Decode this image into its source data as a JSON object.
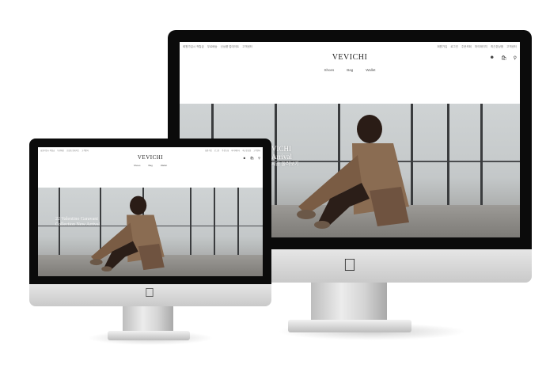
{
  "site": {
    "brand": "VEVICHI",
    "nav": [
      "Shoes",
      "Bag",
      "Wallet"
    ],
    "top_left_links": [
      "회원가입시 적립금",
      "무료배송",
      "신상품 업데이트",
      "고객센터"
    ],
    "top_right_links": [
      "회원가입",
      "로그인",
      "주문조회",
      "마이페이지",
      "최근본상품",
      "고객센터"
    ],
    "icons": [
      "user-icon",
      "bag-icon",
      "search-icon"
    ]
  },
  "hero": {
    "large_caption_line1": "VICHI",
    "large_caption_line2": "Arrival",
    "large_caption_line3": "지금 둘러보기",
    "small_caption_line1": "22 Valentino Garavani",
    "small_caption_line2": "Collection New Arrival"
  },
  "colors": {
    "bezel": "#0b0b0b",
    "chin": "#d6d6d6",
    "page_bg": "#ffffff",
    "header_bg": "#ffffff"
  }
}
